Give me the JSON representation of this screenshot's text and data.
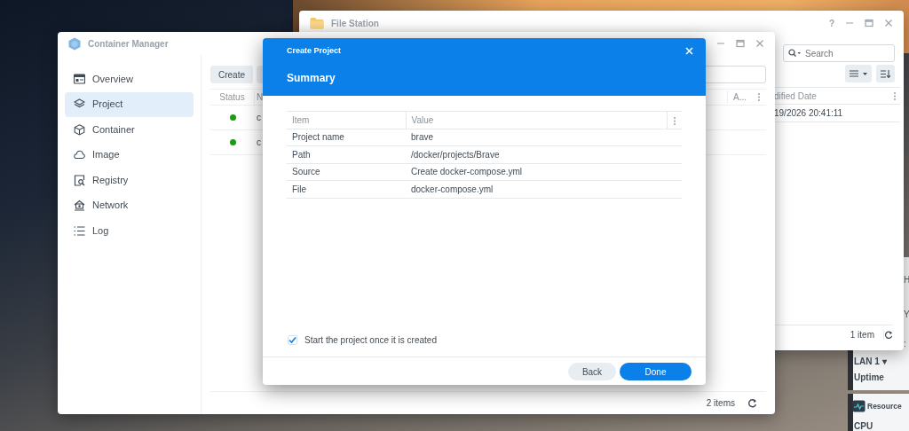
{
  "desktop": {
    "widget": {
      "fragments": [
        "H",
        "Y",
        ":"
      ],
      "lan": "LAN 1 ▾",
      "uptime": "Uptime",
      "resource": "Resource",
      "cpu": "CPU"
    }
  },
  "file_station": {
    "title": "File Station",
    "help": "?",
    "search": {
      "placeholder": "Search"
    },
    "column": "dified Date",
    "row": "19/2026 20:41:11",
    "footer": "1 item"
  },
  "container_manager": {
    "title": "Container Manager",
    "sidebar": [
      {
        "label": "Overview",
        "selected": false
      },
      {
        "label": "Project",
        "selected": true
      },
      {
        "label": "Container",
        "selected": false
      },
      {
        "label": "Image",
        "selected": false
      },
      {
        "label": "Registry",
        "selected": false
      },
      {
        "label": "Network",
        "selected": false
      },
      {
        "label": "Log",
        "selected": false
      }
    ],
    "toolbar": [
      "Create"
    ],
    "columns": [
      "Status",
      "N",
      "A..."
    ],
    "rows": [
      {
        "color": "#13a10e",
        "name": "c"
      },
      {
        "color": "#13a10e",
        "name": "c"
      }
    ],
    "footer": "2 items"
  },
  "dialog": {
    "title": "Create Project",
    "heading": "Summary",
    "columns": [
      "Item",
      "Value"
    ],
    "rows": [
      {
        "item": "Project name",
        "value": "brave"
      },
      {
        "item": "Path",
        "value": "/docker/projects/Brave"
      },
      {
        "item": "Source",
        "value": "Create docker-compose.yml"
      },
      {
        "item": "File",
        "value": "docker-compose.yml"
      }
    ],
    "start_option": {
      "label": "Start the project once it is created",
      "checked": true
    },
    "buttons": [
      {
        "label": "Back",
        "kind": "secondary"
      },
      {
        "label": "Done",
        "kind": "primary"
      }
    ]
  }
}
